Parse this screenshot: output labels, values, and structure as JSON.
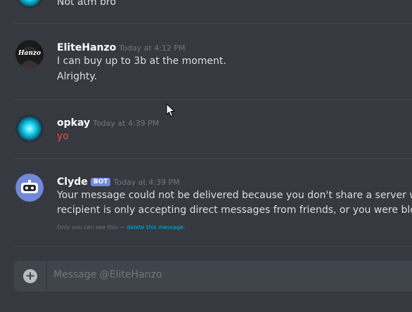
{
  "messages": [
    {
      "text_lines": [
        "Not atm bro"
      ]
    },
    {
      "username": "EliteHanzo",
      "timestamp": "Today at 4:12 PM",
      "avatar_label": "Hanzo",
      "text_lines": [
        "I can buy up to 3b at the moment.",
        "Alrighty."
      ]
    },
    {
      "username": "opkay",
      "timestamp": "Today at 4:39 PM",
      "text_lines": [
        "yo"
      ],
      "text_color": "#f04747"
    },
    {
      "username": "Clyde",
      "badge": "BOT",
      "timestamp": "Today at 4:39 PM",
      "text_lines": [
        "Your message could not be delivered because you don't share a server with t",
        "recipient is only accepting direct messages from friends, or you were blocked"
      ],
      "ephemeral_note": "Only you can see this — ",
      "ephemeral_link": "delete this message."
    }
  ],
  "composer": {
    "placeholder": "Message @EliteHanzo",
    "attach_icon": "plus-circle-icon"
  },
  "colors": {
    "background": "#36393f",
    "input_bg": "#40444b",
    "bot_badge": "#7289da",
    "link": "#00b0f4"
  }
}
